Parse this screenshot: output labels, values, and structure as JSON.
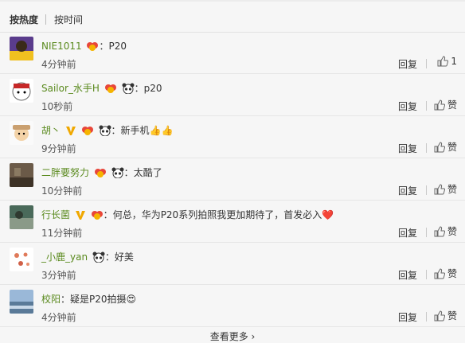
{
  "sort": {
    "hot": "按热度",
    "time": "按时间"
  },
  "comments": [
    {
      "user": "NIE1011",
      "text": "P20",
      "emoji": "",
      "time": "4分钟前",
      "reply": "回复",
      "like": "1",
      "vip": false
    },
    {
      "user": "Sailor_水手H",
      "text": "p20",
      "emoji": "",
      "time": "10秒前",
      "reply": "回复",
      "like": "赞",
      "vip": false,
      "panda": true
    },
    {
      "user": "胡丶",
      "text": "新手机",
      "emoji": "👍👍",
      "time": "9分钟前",
      "reply": "回复",
      "like": "赞",
      "vip": true,
      "panda": true
    },
    {
      "user": "二胖要努力",
      "text": "太酷了",
      "emoji": "",
      "time": "10分钟前",
      "reply": "回复",
      "like": "赞",
      "vip": false,
      "panda": true
    },
    {
      "user": "行长菌",
      "text": "何总，华为P20系列拍照我更加期待了，首发必入",
      "emoji": "❤️",
      "time": "11分钟前",
      "reply": "回复",
      "like": "赞",
      "vip": true,
      "panda": false
    },
    {
      "user": "_小鹿_yan",
      "text": "好美",
      "emoji": "",
      "time": "3分钟前",
      "reply": "回复",
      "like": "赞",
      "vip": false,
      "panda": true,
      "nofan": true
    },
    {
      "user": "校阳",
      "text": "疑是P20拍摄",
      "emoji": "😍",
      "time": "4分钟前",
      "reply": "回复",
      "like": "赞",
      "vip": false,
      "panda": false,
      "nofan": true
    }
  ],
  "more": "查看更多 ›",
  "colors": {
    "name": "#5a8a1e",
    "heart": "#e8463a",
    "vip": "#f0a800"
  }
}
